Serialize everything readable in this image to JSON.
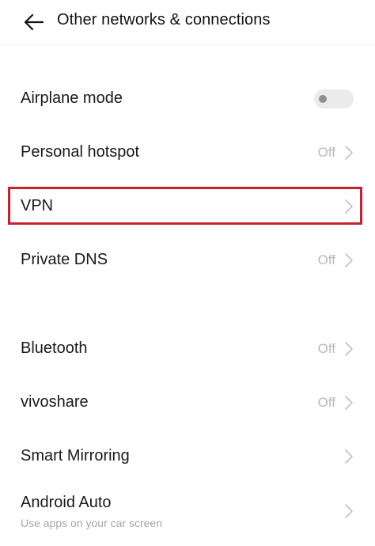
{
  "header": {
    "title": "Other networks & connections",
    "back_icon": "arrow-left-icon"
  },
  "rows": [
    {
      "id": "airplane-mode",
      "label": "Airplane mode",
      "control": "toggle",
      "toggle_on": false
    },
    {
      "id": "personal-hotspot",
      "label": "Personal hotspot",
      "value": "Off",
      "control": "chevron"
    },
    {
      "id": "vpn",
      "label": "VPN",
      "value": "",
      "control": "chevron",
      "highlighted": true
    },
    {
      "id": "private-dns",
      "label": "Private DNS",
      "value": "Off",
      "control": "chevron"
    },
    {
      "id": "bluetooth",
      "label": "Bluetooth",
      "value": "Off",
      "control": "chevron"
    },
    {
      "id": "vivoshare",
      "label": "vivoshare",
      "value": "Off",
      "control": "chevron"
    },
    {
      "id": "smart-mirroring",
      "label": "Smart Mirroring",
      "value": "",
      "control": "chevron"
    },
    {
      "id": "android-auto",
      "label": "Android Auto",
      "sublabel": "Use apps on your car screen",
      "value": "",
      "control": "chevron"
    }
  ],
  "colors": {
    "highlight": "#c8202e",
    "value_text": "#b8b8b8",
    "chevron": "#c4c4c4"
  }
}
